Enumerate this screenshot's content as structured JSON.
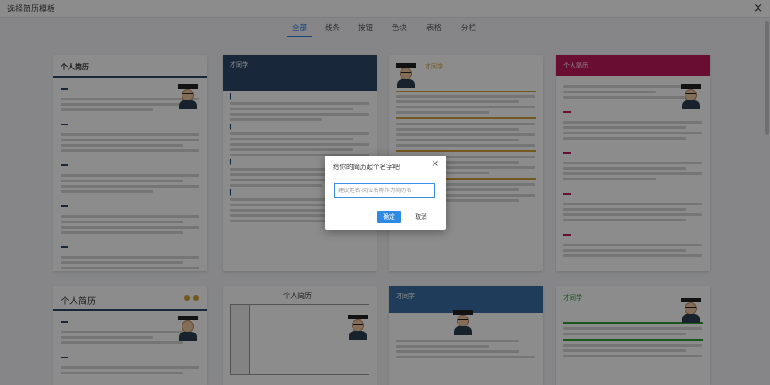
{
  "window": {
    "title": "选择简历模板",
    "close_glyph": "×"
  },
  "tabs": [
    {
      "label": "全部",
      "active": true
    },
    {
      "label": "线条",
      "active": false
    },
    {
      "label": "按钮",
      "active": false
    },
    {
      "label": "色块",
      "active": false
    },
    {
      "label": "表格",
      "active": false
    },
    {
      "label": "分栏",
      "active": false
    }
  ],
  "templates": [
    {
      "heading": "个人简历",
      "accent": "#2c4a6b"
    },
    {
      "heading": "才同学",
      "accent": "#2c4a6b"
    },
    {
      "heading": "才同学",
      "accent": "#d4a13a"
    },
    {
      "heading": "个人简历",
      "accent": "#c2185b"
    },
    {
      "heading": "个人简历",
      "accent": "#2c4a6b"
    },
    {
      "heading": "个人简历",
      "accent": "#555555"
    },
    {
      "heading": "才同学",
      "accent": "#3a6ea5"
    },
    {
      "heading": "才同学",
      "accent": "#2e9e3a"
    }
  ],
  "dialog": {
    "title": "给你的简历起个名字吧",
    "close_glyph": "×",
    "input_placeholder": "建议姓名-岗位名称作为简历名",
    "ok_label": "确定",
    "cancel_label": "取消"
  }
}
